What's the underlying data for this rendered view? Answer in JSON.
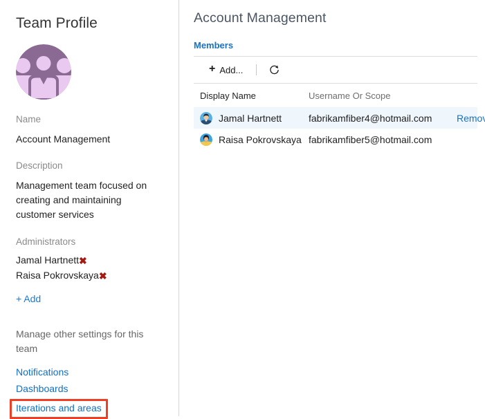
{
  "left": {
    "title": "Team Profile",
    "avatar_icon": "team-group-avatar",
    "name_label": "Name",
    "name_value": "Account Management",
    "description_label": "Description",
    "description_value": "Management team focused on creating and maintaining customer services",
    "administrators_label": "Administrators",
    "administrators": [
      {
        "name": "Jamal Hartnett",
        "remove_glyph": "✖"
      },
      {
        "name": "Raisa Pokrovskaya",
        "remove_glyph": "✖"
      }
    ],
    "add_admin_label": "+ Add",
    "manage_text": "Manage other settings for this team",
    "settings_links": [
      {
        "label": "Notifications",
        "highlighted": false
      },
      {
        "label": "Dashboards",
        "highlighted": false
      },
      {
        "label": "Iterations and areas",
        "highlighted": true
      }
    ],
    "highlight_color": "#ef3e23",
    "link_color": "#1b7ad6"
  },
  "right": {
    "title": "Account Management",
    "tab_label": "Members",
    "toolbar": {
      "add_label": "Add...",
      "add_icon": "plus-icon",
      "refresh_icon": "refresh-icon"
    },
    "table": {
      "columns": [
        "Display Name",
        "Username Or Scope",
        ""
      ],
      "rows": [
        {
          "display_name": "Jamal Hartnett",
          "username": "fabrikamfiber4@hotmail.com",
          "action_label": "Remove",
          "selected": true,
          "avatar_icon": "user-avatar-male"
        },
        {
          "display_name": "Raisa Pokrovskaya",
          "username": "fabrikamfiber5@hotmail.com",
          "action_label": "",
          "selected": false,
          "avatar_icon": "user-avatar-female"
        }
      ]
    },
    "accent_color": "#1672c4",
    "selected_row_color": "#eff6fc"
  }
}
